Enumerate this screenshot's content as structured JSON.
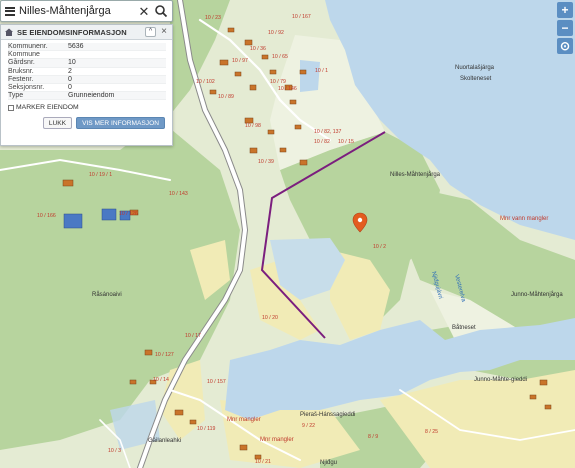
{
  "search": {
    "value": "Nilles-Måhtenjårga",
    "clear_icon": "close-icon",
    "search_icon": "search-icon"
  },
  "panel": {
    "title": "SE EIENDOMSINFORMASJON",
    "collapse_symbol": "^",
    "close_symbol": "×",
    "rows": [
      {
        "label": "Kommunenr.",
        "value": "5636"
      },
      {
        "label": "Kommune",
        "value": ""
      },
      {
        "label": "Gårdsnr.",
        "value": "10"
      },
      {
        "label": "Bruksnr.",
        "value": "2"
      },
      {
        "label": "Festenr.",
        "value": "0"
      },
      {
        "label": "Seksjonsnr.",
        "value": "0"
      },
      {
        "label": "Type",
        "value": "Grunneiendom"
      }
    ],
    "mark_label": "MARKER EIENDOM",
    "close_label": "LUKK",
    "more_label": "VIS MER INFORMASJON"
  },
  "controls": {
    "zoom_in": "+",
    "zoom_out": "−",
    "locate": "⊙"
  },
  "map": {
    "colors": {
      "water": "#bcd6ea",
      "forest": "#b7d49e",
      "open": "#e6ecd6",
      "farmland": "#f2eab4",
      "property_line": "#7a1f7d",
      "marker": "#e35c1f"
    },
    "place_names": [
      "Nuortalašjárga",
      "Skolteneset",
      "Nilles-Måhtenjårga",
      "Råsánoaivi",
      "Båtneset",
      "Junno-Måhtenjårga",
      "Junno-Måhte-gieddi",
      "Pieraš-Hánssagieddi",
      "Gáilanleahki",
      "Njiđgu",
      "Njiđgujávri",
      "Vesterelva",
      "Mnr vann mangler",
      "Mnr mangler",
      "Mnr mangler"
    ],
    "parcels": [
      "10 / 23",
      "10 / 167",
      "10 / 92",
      "10 / 36",
      "10 / 65",
      "10 / 97",
      "10 / 102",
      "10 / 89",
      "10 / 79",
      "10 / 146",
      "10 / 1",
      "10 / 98",
      "10 / 82, 137",
      "10 / 82",
      "10 / 15",
      "10 / 39",
      "10 / 19 / 1",
      "10 / 143",
      "10 / 166",
      "10 / 126",
      "10 / 2",
      "10 / 20",
      "10 / 17",
      "10 / 127",
      "10 / 14",
      "10 / 157",
      "10 / 119",
      "10 / 3",
      "10 / 21",
      "9 / 22",
      "8 / 9",
      "8 / 25"
    ]
  }
}
